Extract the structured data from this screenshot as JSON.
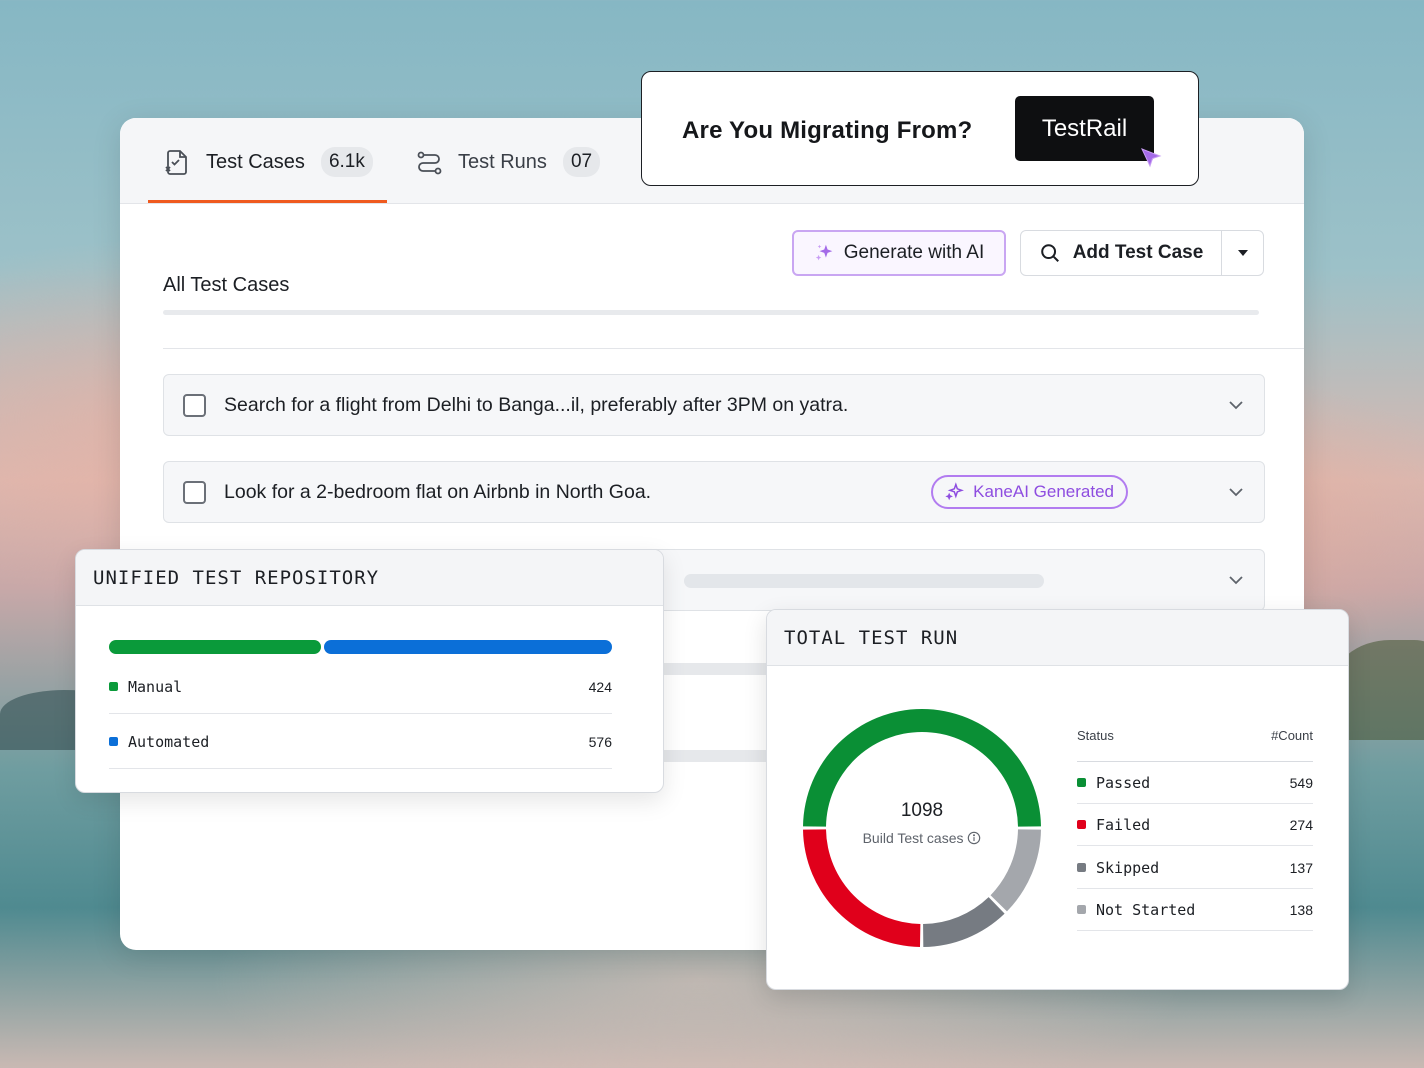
{
  "tabs": {
    "test_cases": {
      "label": "Test Cases",
      "count": "6.1k"
    },
    "test_runs": {
      "label": "Test Runs",
      "count": "07"
    }
  },
  "toolbar": {
    "generate_label": "Generate with AI",
    "add_label": "Add Test Case"
  },
  "section_title": "All Test Cases",
  "cases": [
    {
      "text": "Search for a flight from Delhi to Banga...il, preferably after 3PM on yatra."
    },
    {
      "text": "Look for a 2-bedroom flat on Airbnb in North Goa.",
      "badge": "KaneAI Generated"
    }
  ],
  "migrate": {
    "question": "Are You Migrating From?",
    "button_label": "TestRail"
  },
  "repository": {
    "title": "UNIFIED TEST REPOSITORY",
    "items": [
      {
        "label": "Manual",
        "value": "424",
        "color": "#0a9a3a"
      },
      {
        "label": "Automated",
        "value": "576",
        "color": "#0b6fd8"
      }
    ]
  },
  "test_run": {
    "title": "TOTAL TEST RUN",
    "total": "1098",
    "total_caption": "Build Test cases",
    "table_head": {
      "status": "Status",
      "count": "#Count"
    },
    "statuses": [
      {
        "label": "Passed",
        "value": "549",
        "color": "#0a8f35"
      },
      {
        "label": "Failed",
        "value": "274",
        "color": "#e0001b"
      },
      {
        "label": "Skipped",
        "value": "137",
        "color": "#767b82"
      },
      {
        "label": "Not Started",
        "value": "138",
        "color": "#a4a7ac"
      }
    ]
  },
  "colors": {
    "accent_tab": "#ef5a1f",
    "ai_purple": "#8e4de0"
  }
}
